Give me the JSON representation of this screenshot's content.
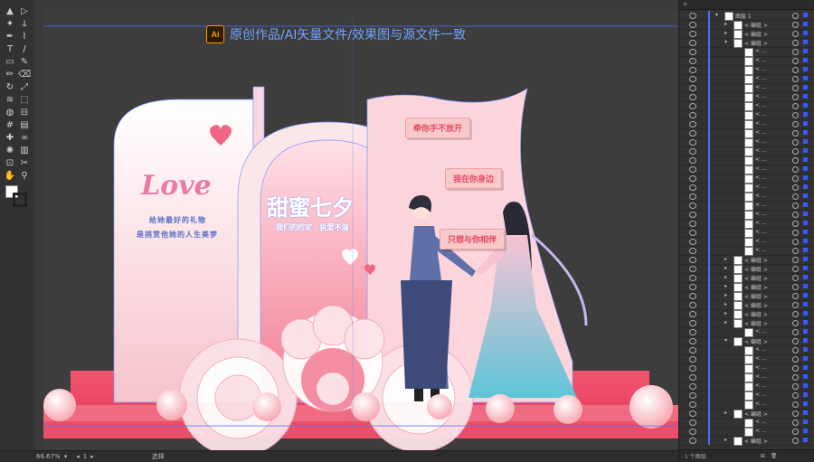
{
  "banner": {
    "app_badge": "Ai",
    "text": "原创作品/AI矢量文件/效果图与源文件一致"
  },
  "artwork": {
    "love": "Love",
    "panel_line1": "给她最好的礼物",
    "panel_line2": "是捎赏他她的人生美梦",
    "title": "甜蜜七夕",
    "subtitle": "我们的约定 · 执爱不渝",
    "bubble1": "牵你手不放开",
    "bubble2": "我在你身边",
    "bubble3": "只想与你相伴"
  },
  "status": {
    "zoom": "66.67%",
    "artboard": "1",
    "tool": "选择"
  },
  "layers_panel": {
    "top_layer": "图层 1",
    "group_label": "< 编组 >",
    "path_label": "< ...",
    "footer": "1 个图层"
  },
  "colors": {
    "accent_blue": "#6fa4ff",
    "pink": "#f7b0bf",
    "selection": "#4a6cff"
  },
  "toolbar_icons": [
    "select-arrow-icon",
    "direct-select-icon",
    "magic-wand-icon",
    "lasso-icon",
    "pen-icon",
    "curvature-icon",
    "type-icon",
    "line-icon",
    "rectangle-icon",
    "paintbrush-icon",
    "pencil-icon",
    "eraser-icon",
    "rotate-icon",
    "scale-icon",
    "width-icon",
    "free-transform-icon",
    "shape-builder-icon",
    "perspective-icon",
    "mesh-icon",
    "gradient-icon",
    "eyedropper-icon",
    "blend-icon",
    "symbol-sprayer-icon",
    "graph-icon",
    "artboard-icon",
    "slice-icon",
    "hand-icon",
    "zoom-icon"
  ]
}
